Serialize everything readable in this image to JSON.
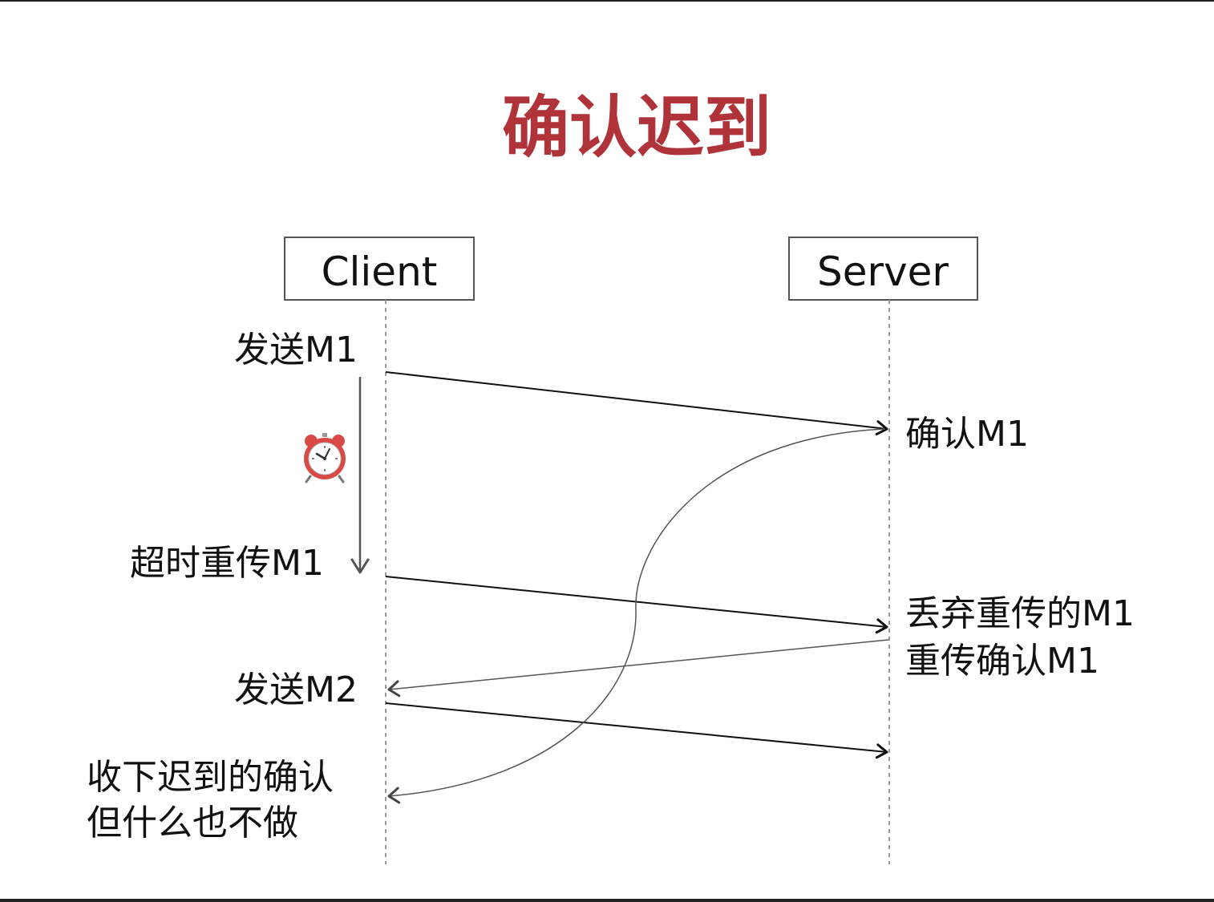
{
  "title": "确认迟到",
  "actors": {
    "client": "Client",
    "server": "Server"
  },
  "client_labels": {
    "send_m1": "发送M1",
    "timeout_resend_m1": "超时重传M1",
    "send_m2": "发送M2",
    "late_ack_line1": "收下迟到的确认",
    "late_ack_line2": "但什么也不做"
  },
  "server_labels": {
    "ack_m1": "确认M1",
    "discard_line1": "丢弃重传的M1",
    "discard_line2": "重传确认M1"
  },
  "icons": {
    "timer": "alarm-clock-icon"
  },
  "colors": {
    "title": "#b0333a",
    "arrow": "#111111",
    "lifeline": "#999999"
  }
}
